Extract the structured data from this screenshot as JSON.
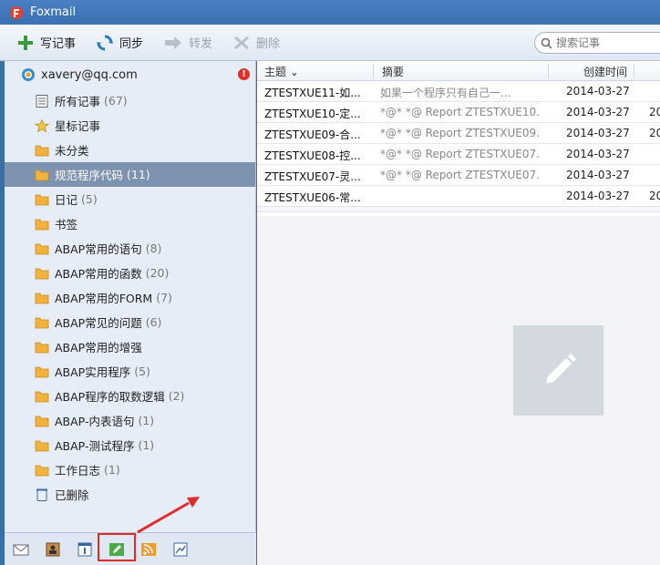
{
  "window": {
    "title": "Foxmail"
  },
  "toolbar": {
    "write_label": "写记事",
    "sync_label": "同步",
    "forward_label": "转发",
    "delete_label": "删除",
    "search_placeholder": "搜索记事"
  },
  "sidebar": {
    "account": "xavery@qq.com",
    "alert": "!",
    "items": [
      {
        "label": "所有记事",
        "count": "(67)",
        "icon": "note-list-icon"
      },
      {
        "label": "星标记事",
        "count": "",
        "icon": "star-icon"
      },
      {
        "label": "未分类",
        "count": "",
        "icon": "folder-icon"
      },
      {
        "label": "规范程序代码",
        "count": "(11)",
        "icon": "folder-icon",
        "selected": true
      },
      {
        "label": "日记",
        "count": "(5)",
        "icon": "folder-icon"
      },
      {
        "label": "书签",
        "count": "",
        "icon": "folder-icon"
      },
      {
        "label": "ABAP常用的语句",
        "count": "(8)",
        "icon": "folder-icon"
      },
      {
        "label": "ABAP常用的函数",
        "count": "(20)",
        "icon": "folder-icon"
      },
      {
        "label": "ABAP常用的FORM",
        "count": "(7)",
        "icon": "folder-icon"
      },
      {
        "label": "ABAP常见的问题",
        "count": "(6)",
        "icon": "folder-icon"
      },
      {
        "label": "ABAP常用的增强",
        "count": "",
        "icon": "folder-icon"
      },
      {
        "label": "ABAP实用程序",
        "count": "(5)",
        "icon": "folder-icon"
      },
      {
        "label": "ABAP程序的取数逻辑",
        "count": "(2)",
        "icon": "folder-icon"
      },
      {
        "label": "ABAP-内表语句",
        "count": "(1)",
        "icon": "folder-icon"
      },
      {
        "label": "ABAP-测试程序",
        "count": "(1)",
        "icon": "folder-icon"
      },
      {
        "label": "工作日志",
        "count": "(1)",
        "icon": "folder-icon"
      },
      {
        "label": "已删除",
        "count": "",
        "icon": "trash-icon"
      }
    ]
  },
  "list": {
    "headers": {
      "subject": "主题",
      "summary": "摘要",
      "created": "创建时间"
    },
    "rows": [
      {
        "subject": "ZTESTXUE11-如...",
        "summary": "如果一个程序只有自己一...",
        "date": "2014-03-27",
        "extra": ""
      },
      {
        "subject": "ZTESTXUE10-定...",
        "summary": "*@* *@ Report ZTESTXUE10...",
        "date": "2014-03-27",
        "extra": "20"
      },
      {
        "subject": "ZTESTXUE09-合...",
        "summary": "*@* *@ Report ZTESTXUE09...",
        "date": "2014-03-27",
        "extra": "20"
      },
      {
        "subject": "ZTESTXUE08-控...",
        "summary": "*@* *@ Report ZTESTXUE07...",
        "date": "2014-03-27",
        "extra": ""
      },
      {
        "subject": "ZTESTXUE07-灵...",
        "summary": "*@* *@ Report ZTESTXUE07...",
        "date": "2014-03-27",
        "extra": ""
      },
      {
        "subject": "ZTESTXUE06-常...",
        "summary": "",
        "date": "2014-03-27",
        "extra": "20"
      }
    ]
  },
  "bottombar": {
    "buttons": [
      "mail-icon",
      "contacts-icon",
      "calendar-icon",
      "notes-icon",
      "rss-icon",
      "chart-icon"
    ],
    "active": "notes-icon"
  },
  "colors": {
    "selected": "#7d93b0",
    "highlight": "#e02a2a",
    "titlebar": "#3a6fb0"
  }
}
